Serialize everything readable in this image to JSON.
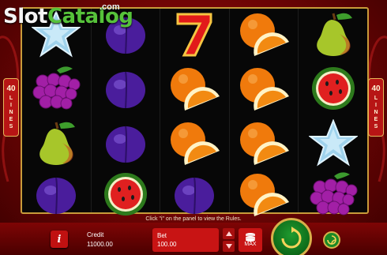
{
  "watermark": {
    "slot": "Slot",
    "catalog": "Catalog",
    "com": ".com"
  },
  "lines_badge": {
    "number": "40",
    "word_letters": [
      "L",
      "I",
      "N",
      "E",
      "S"
    ]
  },
  "reels": [
    [
      "star",
      "grapes",
      "pear",
      "plum"
    ],
    [
      "plum",
      "plum",
      "plum",
      "watermelon"
    ],
    [
      "seven",
      "orange",
      "orange",
      "plum"
    ],
    [
      "orange",
      "orange",
      "orange",
      "orange"
    ],
    [
      "pear",
      "watermelon",
      "star",
      "grapes"
    ]
  ],
  "hint_text": "Click \"i\" on the panel to view the Rules.",
  "panel": {
    "info_label": "i",
    "credit_label": "Credit",
    "credit_value": "11000.00",
    "bet_label": "Bet",
    "bet_value": "100.00",
    "max_label": "MAX"
  },
  "icons": {
    "bet_up": "triangle-up-icon",
    "bet_down": "triangle-down-icon",
    "max": "coin-stack-icon",
    "spin": "spin-arrows-icon",
    "autoplay": "autoplay-icon"
  },
  "colors": {
    "background": "#8a0606",
    "reel_bg": "#070707",
    "frame_gold": "#c89b3a",
    "panel_red": "#c81414",
    "spin_green": "#1a8a26"
  }
}
